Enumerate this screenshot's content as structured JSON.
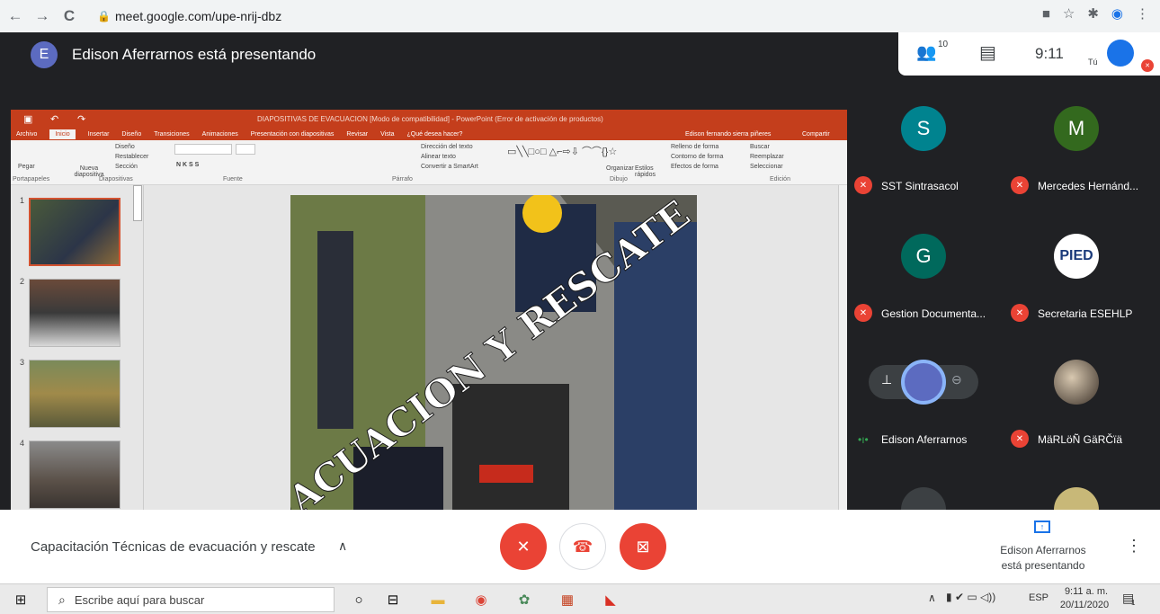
{
  "browser": {
    "back_icon": "←",
    "forward_icon": "→",
    "reload_icon": "C",
    "url": "meet.google.com/upe-nrij-dbz",
    "icons": [
      "camera-icon",
      "star-icon",
      "extensions-icon",
      "profile-icon",
      "menu-icon"
    ]
  },
  "meet": {
    "presenter_initial": "E",
    "presenting_title": "Edison Aferrarnos está presentando",
    "participant_count": "10",
    "clock": "9:11",
    "self_label": "Tú"
  },
  "ppt": {
    "title": "DIAPOSITIVAS DE EVACUACION [Modo de compatibilidad] - PowerPoint (Error de activación de productos)",
    "user": "Edison fernando sierra piñeres",
    "share_label": "Compartir",
    "tabs": [
      "Archivo",
      "Inicio",
      "Insertar",
      "Diseño",
      "Transiciones",
      "Animaciones",
      "Presentación con diapositivas",
      "Revisar",
      "Vista",
      "¿Qué desea hacer?"
    ],
    "ribbon": {
      "pegar": "Pegar",
      "nueva": "Nueva diapositiva",
      "diseno": "Diseño",
      "restablecer": "Restablecer",
      "seccion": "Sección",
      "direccion": "Dirección del texto",
      "alinear": "Alinear texto",
      "smartart": "Convertir a SmartArt",
      "organizar": "Organizar",
      "estilos": "Estilos rápidos",
      "relleno": "Relleno de forma",
      "contorno": "Contorno de forma",
      "efectos": "Efectos de forma",
      "buscar": "Buscar",
      "reemplazar": "Reemplazar",
      "seleccionar": "Seleccionar",
      "groups": [
        "Portapapeles",
        "Diapositivas",
        "Fuente",
        "Párrafo",
        "Dibujo",
        "Edición"
      ]
    },
    "thumb_numbers": [
      "1",
      "2",
      "3",
      "4"
    ],
    "slide_text": "EVACUACION Y RESCATE"
  },
  "tiles": [
    {
      "initial": "S",
      "color": "#00838f",
      "name": "SST Sintrasacol",
      "muted": true
    },
    {
      "initial": "M",
      "color": "#33691e",
      "name": "Mercedes Hernánd...",
      "muted": true
    },
    {
      "initial": "G",
      "color": "#00695c",
      "name": "Gestion Documenta...",
      "muted": true
    },
    {
      "initial": "PIED",
      "color": "#ffffff",
      "name": "Secretaria ESEHLP",
      "muted": true
    },
    {
      "initial": "",
      "color": "#3c4043",
      "name": "Edison Aferrarnos",
      "muted": false
    },
    {
      "initial": "",
      "color": "#6b5a4a",
      "name": "MäRLöÑ GäRČïä",
      "muted": true
    }
  ],
  "bottom": {
    "meeting_title": "Capacitación Técnicas de evacuación y rescate",
    "presenting_line1": "Edison Aferrarnos",
    "presenting_line2": "está presentando"
  },
  "taskbar": {
    "search_placeholder": "Escribe aquí para buscar",
    "lang": "ESP",
    "time": "9:11 a. m.",
    "date": "20/11/2020",
    "notification_count": "1"
  },
  "colors": {
    "meet_red": "#ea4335",
    "ppt_orange": "#c43e1c",
    "meet_dark": "#202124"
  }
}
